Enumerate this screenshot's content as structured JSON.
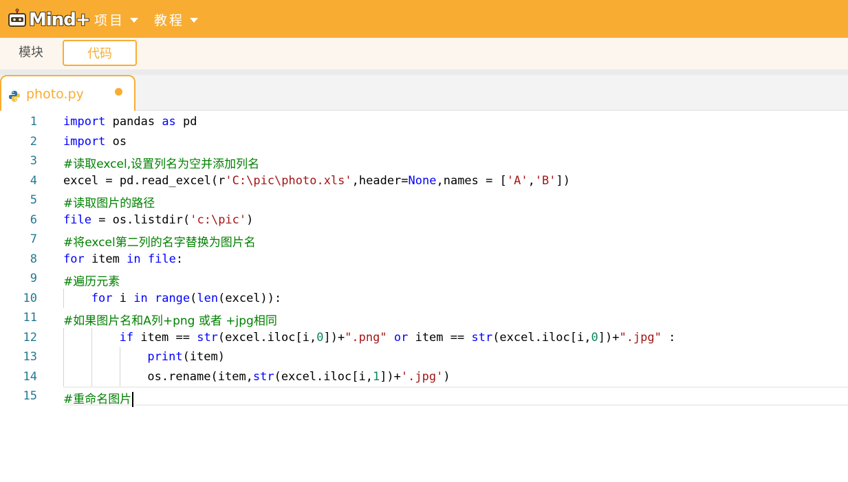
{
  "header": {
    "logo_text": "Mind+",
    "menus": [
      {
        "label": "项目"
      },
      {
        "label": "教程"
      }
    ]
  },
  "mode_tabs": [
    {
      "label": "模块",
      "active": false
    },
    {
      "label": "代码",
      "active": true
    }
  ],
  "file_tab": {
    "filename": "photo.py",
    "unsaved": true
  },
  "editor": {
    "current_line": 15,
    "lines": [
      {
        "n": "1",
        "indent": 0,
        "tokens": [
          {
            "t": "import",
            "c": "kw"
          },
          {
            "t": " pandas "
          },
          {
            "t": "as",
            "c": "kw"
          },
          {
            "t": " pd"
          }
        ]
      },
      {
        "n": "2",
        "indent": 0,
        "tokens": [
          {
            "t": "import",
            "c": "kw"
          },
          {
            "t": " os"
          }
        ]
      },
      {
        "n": "3",
        "indent": 0,
        "comment": true,
        "tokens": [
          {
            "t": "#读取excel,设置列名为空并添加列名"
          }
        ]
      },
      {
        "n": "4",
        "indent": 0,
        "tokens": [
          {
            "t": "excel = pd.read_excel(r"
          },
          {
            "t": "'C:\\pic\\photo.xls'",
            "c": "str"
          },
          {
            "t": ",header="
          },
          {
            "t": "None",
            "c": "kw"
          },
          {
            "t": ",names = ["
          },
          {
            "t": "'A'",
            "c": "str"
          },
          {
            "t": ","
          },
          {
            "t": "'B'",
            "c": "str"
          },
          {
            "t": "])"
          }
        ]
      },
      {
        "n": "5",
        "indent": 0,
        "comment": true,
        "tokens": [
          {
            "t": "#读取图片的路径"
          }
        ]
      },
      {
        "n": "6",
        "indent": 0,
        "tokens": [
          {
            "t": "file",
            "c": "kw"
          },
          {
            "t": " = os.listdir("
          },
          {
            "t": "'c:\\pic'",
            "c": "str"
          },
          {
            "t": ")"
          }
        ]
      },
      {
        "n": "7",
        "indent": 0,
        "comment": true,
        "tokens": [
          {
            "t": "#将excel第二列的名字替换为图片名"
          }
        ]
      },
      {
        "n": "8",
        "indent": 0,
        "tokens": [
          {
            "t": "for",
            "c": "kw"
          },
          {
            "t": " item "
          },
          {
            "t": "in",
            "c": "kw"
          },
          {
            "t": " "
          },
          {
            "t": "file",
            "c": "kw"
          },
          {
            "t": ":"
          }
        ]
      },
      {
        "n": "9",
        "indent": 0,
        "comment": true,
        "tokens": [
          {
            "t": "#遍历元素"
          }
        ]
      },
      {
        "n": "10",
        "indent": 1,
        "tokens": [
          {
            "t": "for",
            "c": "kw"
          },
          {
            "t": " i "
          },
          {
            "t": "in",
            "c": "kw"
          },
          {
            "t": " "
          },
          {
            "t": "range",
            "c": "kw"
          },
          {
            "t": "("
          },
          {
            "t": "len",
            "c": "kw"
          },
          {
            "t": "(excel)):"
          }
        ]
      },
      {
        "n": "11",
        "indent": 0,
        "comment": true,
        "tokens": [
          {
            "t": "#如果图片名和A列+png 或者 +jpg相同"
          }
        ]
      },
      {
        "n": "12",
        "indent": 2,
        "tokens": [
          {
            "t": "if",
            "c": "kw"
          },
          {
            "t": " item == "
          },
          {
            "t": "str",
            "c": "kw"
          },
          {
            "t": "(excel.iloc[i,"
          },
          {
            "t": "0",
            "c": "num"
          },
          {
            "t": "])+"
          },
          {
            "t": "\".png\"",
            "c": "str"
          },
          {
            "t": " "
          },
          {
            "t": "or",
            "c": "kw"
          },
          {
            "t": " item == "
          },
          {
            "t": "str",
            "c": "kw"
          },
          {
            "t": "(excel.iloc[i,"
          },
          {
            "t": "0",
            "c": "num"
          },
          {
            "t": "])+"
          },
          {
            "t": "\".jpg\"",
            "c": "str"
          },
          {
            "t": " :"
          }
        ]
      },
      {
        "n": "13",
        "indent": 3,
        "tokens": [
          {
            "t": "print",
            "c": "kw"
          },
          {
            "t": "(item)"
          }
        ]
      },
      {
        "n": "14",
        "indent": 3,
        "tokens": [
          {
            "t": "os.rename(item,"
          },
          {
            "t": "str",
            "c": "kw"
          },
          {
            "t": "(excel.iloc[i,"
          },
          {
            "t": "1",
            "c": "num"
          },
          {
            "t": "])+"
          },
          {
            "t": "'.jpg'",
            "c": "str"
          },
          {
            "t": ")"
          }
        ]
      },
      {
        "n": "15",
        "indent": 0,
        "comment": true,
        "tokens": [
          {
            "t": "#重命名图片"
          }
        ]
      }
    ]
  },
  "colors": {
    "accent": "#f8ad32",
    "keyword": "#0000ff",
    "string": "#a31515",
    "number": "#098658",
    "comment": "#008000",
    "line_number": "#237893"
  }
}
